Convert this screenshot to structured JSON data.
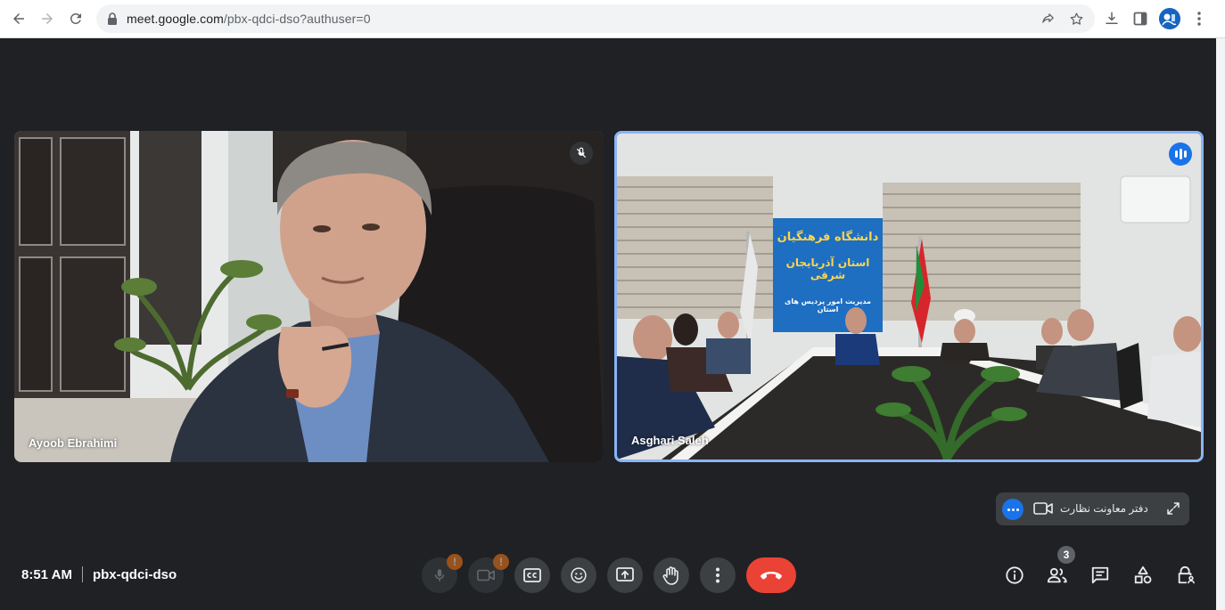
{
  "browser": {
    "url_host": "meet.google.com",
    "url_path": "/pbx-qdci-dso?authuser=0"
  },
  "participants": [
    {
      "name": "Ayoob Ebrahimi",
      "muted": true
    },
    {
      "name": "Asghari Saleh",
      "speaking": true
    }
  ],
  "room_banner": {
    "line1": "دانشگاه فرهنگیان",
    "line2": "استان آذربایجان شرقی",
    "line3": "مدیریت امور پردیس های استان"
  },
  "self_view": {
    "name": "دفتر معاونت نظارت"
  },
  "meeting": {
    "time": "8:51 AM",
    "code": "pbx-qdci-dso"
  },
  "controls": {
    "mic_warning": "!",
    "cam_warning": "!",
    "people_count": "3"
  },
  "colors": {
    "background": "#202124",
    "control": "#3c4043",
    "hangup": "#ea4335",
    "accent": "#1a73e8",
    "warning": "#fa7b17",
    "active_border": "#8ab4f8"
  }
}
